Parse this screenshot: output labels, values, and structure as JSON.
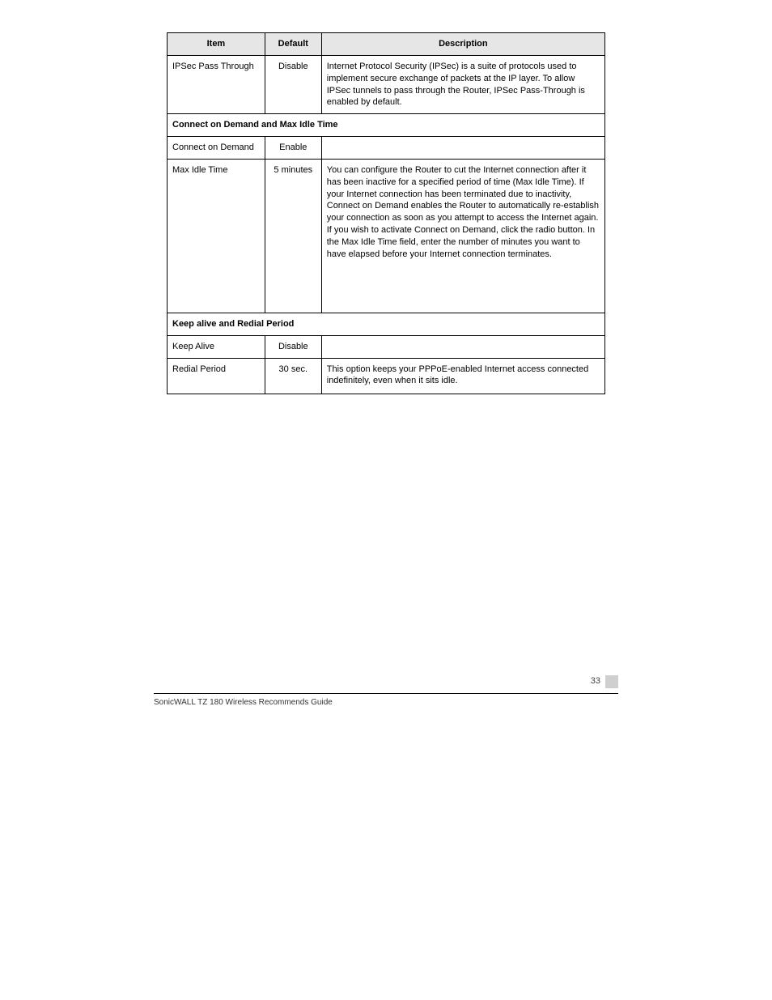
{
  "table": {
    "headers": {
      "item": "Item",
      "def": "Default",
      "desc": "Description"
    },
    "rows": [
      {
        "item": "IPSec Pass Through",
        "def": "Disable",
        "desc": "Internet Protocol Security (IPSec) is a suite of protocols used to implement secure exchange of packets at the IP layer. To allow IPSec tunnels to pass through the Router, IPSec Pass-Through is enabled by default."
      }
    ],
    "section1": "Connect on Demand and Max Idle Time",
    "rows2": [
      {
        "item": "Connect on Demand",
        "def": "Enable",
        "desc": ""
      },
      {
        "item": "Max Idle Time",
        "def": "5 minutes",
        "desc": "You can configure the Router to cut the Internet connection after it has been inactive for a specified period of time (Max Idle Time). If your Internet connection has been terminated due to inactivity, Connect on Demand enables the Router to automatically re-establish your connection as soon as you attempt to access the Internet again. If you wish to activate Connect on Demand, click the radio button. In the Max Idle Time field, enter the number of minutes you want to have elapsed before your Internet connection terminates."
      }
    ],
    "section2": "Keep alive and Redial Period",
    "rows3": [
      {
        "item": "Keep Alive",
        "def": "Disable",
        "desc": ""
      },
      {
        "item": "Redial Period",
        "def": "30 sec.",
        "desc": "This option keeps your PPPoE-enabled Internet access connected indefinitely, even when it sits idle."
      }
    ]
  },
  "footer": {
    "page": "33",
    "text": "SonicWALL TZ 180 Wireless Recommends Guide"
  }
}
